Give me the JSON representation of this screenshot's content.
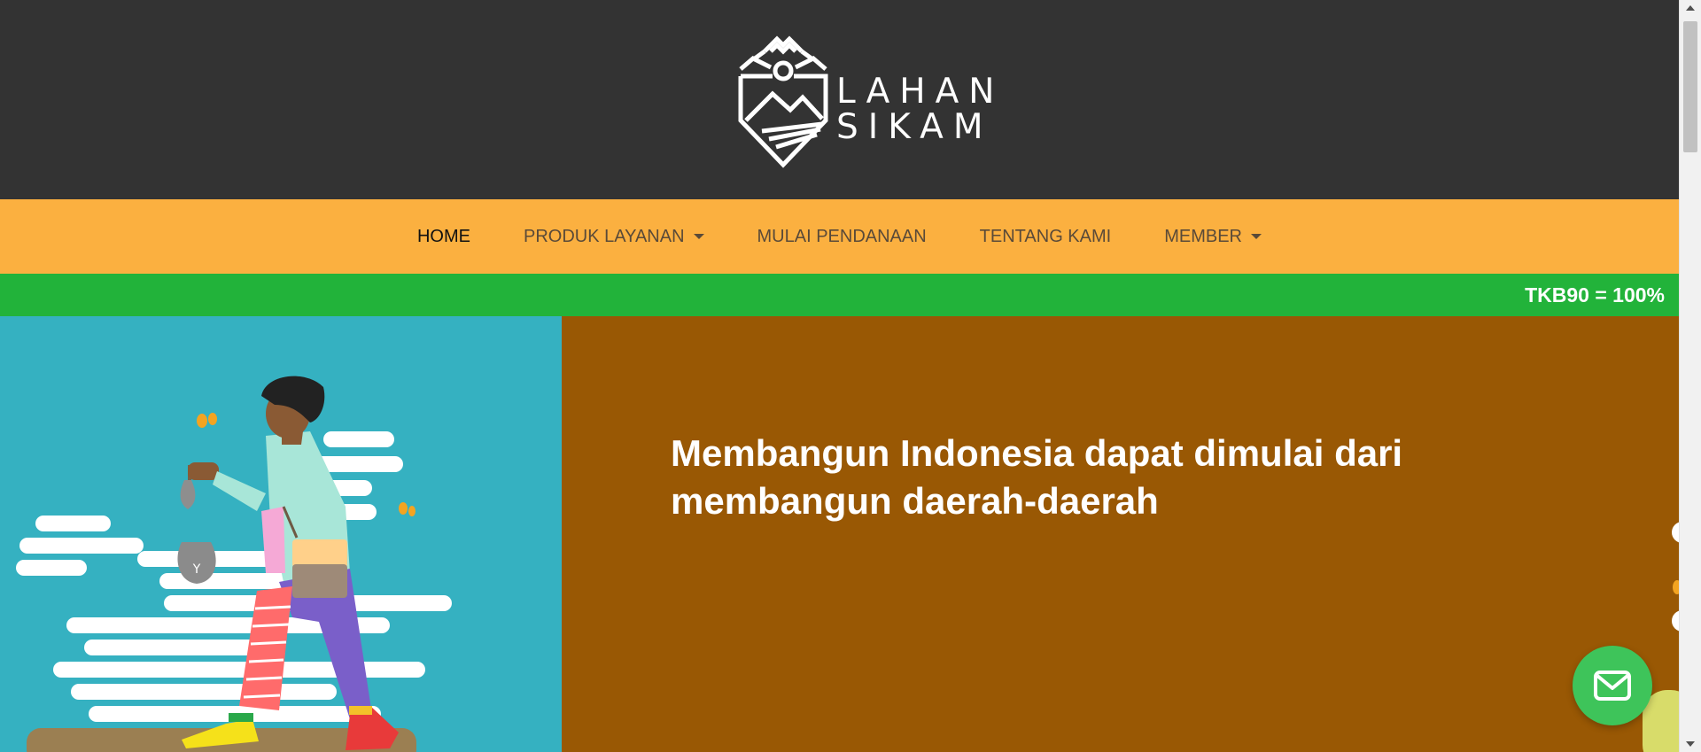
{
  "brand": {
    "line1": "LAHAN",
    "line2": "SIKAM",
    "logo_icon": "crown-mountain-shield-icon"
  },
  "nav": {
    "items": [
      {
        "label": "HOME",
        "active": true,
        "has_dropdown": false
      },
      {
        "label": "PRODUK LAYANAN",
        "active": false,
        "has_dropdown": true
      },
      {
        "label": "MULAI PENDANAAN",
        "active": false,
        "has_dropdown": false
      },
      {
        "label": "TENTANG KAMI",
        "active": false,
        "has_dropdown": false
      },
      {
        "label": "MEMBER",
        "active": false,
        "has_dropdown": true
      }
    ]
  },
  "ticker": {
    "text": "TKB90 = 100%"
  },
  "hero": {
    "headline": "Membangun Indonesia dapat dimulai dari membangun daerah-daerah"
  },
  "chat": {
    "icon": "mail-icon"
  },
  "colors": {
    "header_bg": "#333333",
    "nav_bg": "#fbb040",
    "ticker_bg": "#22b33a",
    "hero_left_bg": "#35b1c1",
    "hero_right_bg": "#995804",
    "chat_bg": "#3ec45a"
  }
}
